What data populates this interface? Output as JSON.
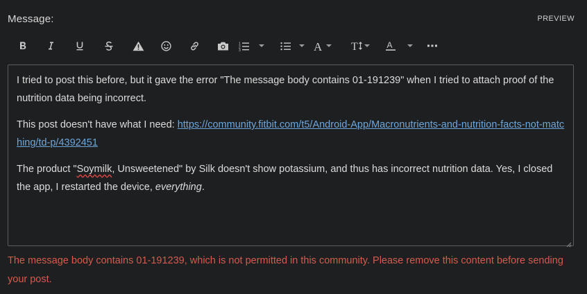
{
  "header": {
    "label": "Message:",
    "preview": "PREVIEW"
  },
  "toolbar": {
    "items": [
      {
        "name": "bold",
        "icon": "bold-icon"
      },
      {
        "name": "italic",
        "icon": "italic-icon"
      },
      {
        "name": "underline",
        "icon": "underline-icon"
      },
      {
        "name": "strikethrough",
        "icon": "strikethrough-icon"
      },
      {
        "name": "spoiler",
        "icon": "warning-icon"
      },
      {
        "name": "emoji",
        "icon": "smiley-icon"
      },
      {
        "name": "link",
        "icon": "link-icon"
      },
      {
        "name": "photo",
        "icon": "camera-icon"
      },
      {
        "name": "numbered-list",
        "icon": "numbered-list-icon"
      },
      {
        "name": "bulleted-list",
        "icon": "bulleted-list-icon"
      },
      {
        "name": "font-style",
        "icon": "font-icon"
      },
      {
        "name": "font-size",
        "icon": "text-size-icon"
      },
      {
        "name": "text-color",
        "icon": "text-color-icon"
      },
      {
        "name": "more",
        "icon": "more-icon"
      }
    ]
  },
  "editor": {
    "p1": "I tried to post this before, but it gave the error \"The message body contains 01-191239\" when I tried to attach proof of the nutrition data being incorrect.",
    "p2_prefix": "This post doesn't have what I need: ",
    "p2_link": "https://community.fitbit.com/t5/Android-App/Macronutrients-and-nutrition-facts-not-matching/td-p/4392451",
    "p3_a": "The product \"",
    "p3_misspelled": "Soymilk",
    "p3_b": ", Unsweetened\" by Silk doesn't show potassium, and thus has incorrect nutrition data. Yes, I closed the app, I restarted the device, ",
    "p3_em": "everything",
    "p3_c": "."
  },
  "error": "The message body contains 01-191239, which is not permitted in this community. Please remove this content before sending your post.",
  "colors": {
    "background": "#1e1f21",
    "link": "#6fa6d9",
    "error": "#d65a4d",
    "border": "#5a5c60"
  }
}
